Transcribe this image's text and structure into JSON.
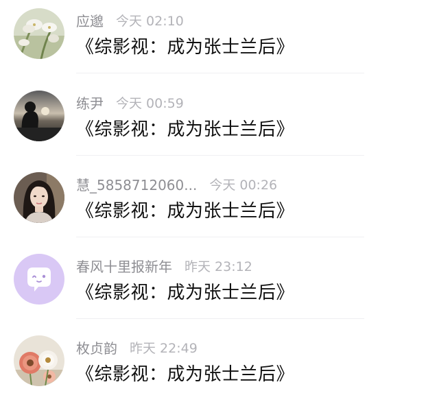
{
  "messages": [
    {
      "name": "应邈",
      "time": "今天 02:10",
      "text": "《综影视：成为张士兰后》",
      "avatar_icon": "lily-flower-avatar"
    },
    {
      "name": "练尹",
      "time": "今天 00:59",
      "text": "《综影视：成为张士兰后》",
      "avatar_icon": "silhouette-sunset-avatar"
    },
    {
      "name": "慧_5858712060...",
      "time": "今天 00:26",
      "text": "《综影视：成为张士兰后》",
      "avatar_icon": "woman-portrait-avatar"
    },
    {
      "name": "春风十里报新年",
      "time": "昨天 23:12",
      "text": "《综影视：成为张士兰后》",
      "avatar_icon": "default-chat-bubble-avatar"
    },
    {
      "name": "枚贞韵",
      "time": "昨天 22:49",
      "text": "《综影视：成为张士兰后》",
      "avatar_icon": "gerbera-flowers-avatar"
    }
  ],
  "colors": {
    "name_text": "#8e8e93",
    "time_text": "#b3b3b8",
    "message_text": "#111111",
    "default_avatar_bg": "#d9c8f5",
    "divider": "#efeff2"
  }
}
